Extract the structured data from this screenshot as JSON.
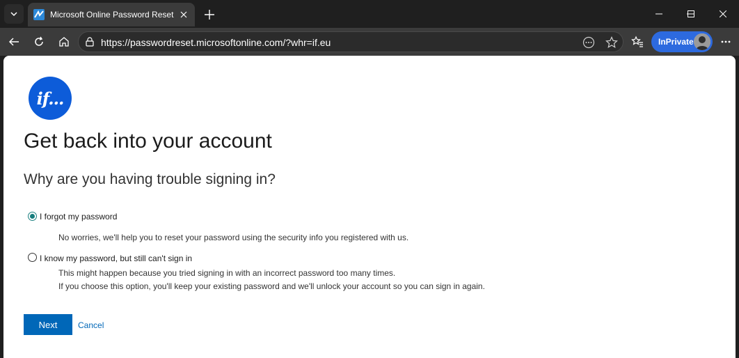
{
  "browser": {
    "tab": {
      "title": "Microsoft Online Password Reset",
      "favicon": "password-reset-favicon"
    },
    "address": {
      "url": "https://passwordreset.microsoftonline.com/?whr=if.eu"
    },
    "inprivate_label": "InPrivate"
  },
  "page": {
    "logo_text": "if...",
    "heading": "Get back into your account",
    "subheading": "Why are you having trouble signing in?",
    "options": [
      {
        "label": "I forgot my password",
        "selected": true,
        "description": [
          "No worries, we'll help you to reset your password using the security info you registered with us."
        ]
      },
      {
        "label": "I know my password, but still can't sign in",
        "selected": false,
        "description": [
          "This might happen because you tried signing in with an incorrect password too many times.",
          "If you choose this option, you'll keep your existing password and we'll unlock your account so you can sign in again."
        ]
      }
    ],
    "next_label": "Next",
    "cancel_label": "Cancel"
  },
  "colors": {
    "accent": "#0067b8",
    "logo_bg": "#0d5cd9",
    "inprivate_bg": "#2d6adf",
    "radio_selected": "#167d7d"
  }
}
